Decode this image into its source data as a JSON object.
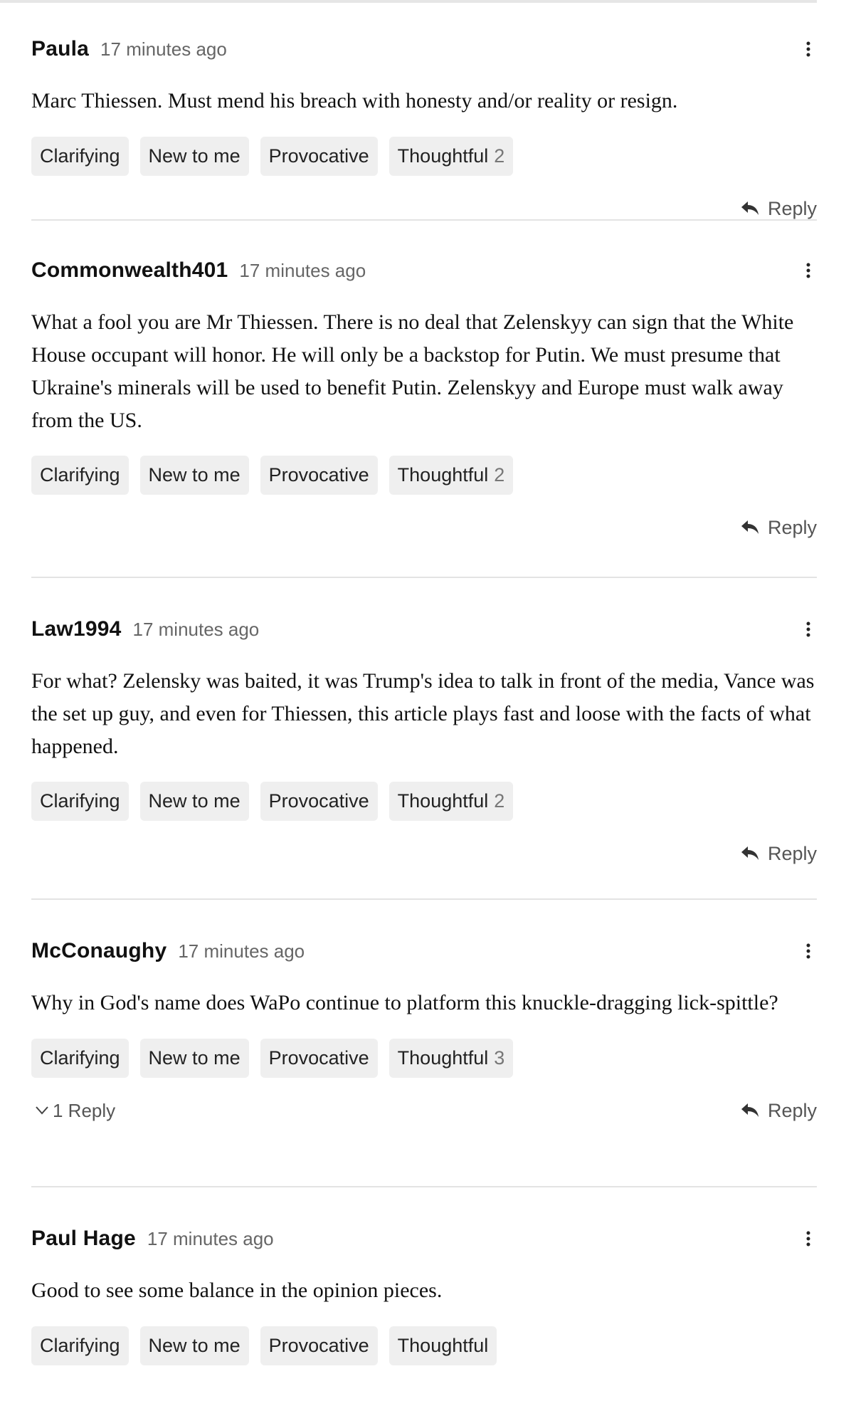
{
  "comments": [
    {
      "author": "Paula",
      "time": "17 minutes ago",
      "body": "Marc Thiessen. Must mend his breach with honesty and/or reality or resign.",
      "reactions": [
        {
          "label": "Clarifying",
          "count": ""
        },
        {
          "label": "New to me",
          "count": ""
        },
        {
          "label": "Provocative",
          "count": ""
        },
        {
          "label": "Thoughtful",
          "count": "2"
        }
      ],
      "replies_label": "",
      "reply_label": "Reply"
    },
    {
      "author": "Commonwealth401",
      "time": "17 minutes ago",
      "body": "What a fool you are Mr Thiessen. There is no deal that Zelenskyy can sign that the White House occupant will honor. He will only be a backstop for Putin. We must presume that Ukraine's minerals will be used to benefit Putin. Zelenskyy and Europe must walk away from the US.",
      "reactions": [
        {
          "label": "Clarifying",
          "count": ""
        },
        {
          "label": "New to me",
          "count": ""
        },
        {
          "label": "Provocative",
          "count": ""
        },
        {
          "label": "Thoughtful",
          "count": "2"
        }
      ],
      "replies_label": "",
      "reply_label": "Reply"
    },
    {
      "author": "Law1994",
      "time": "17 minutes ago",
      "body": "For what? Zelensky was baited, it was Trump's idea to talk in front of the media, Vance was the set up guy, and even for Thiessen, this article plays fast and loose with the facts of what happened.",
      "reactions": [
        {
          "label": "Clarifying",
          "count": ""
        },
        {
          "label": "New to me",
          "count": ""
        },
        {
          "label": "Provocative",
          "count": ""
        },
        {
          "label": "Thoughtful",
          "count": "2"
        }
      ],
      "replies_label": "",
      "reply_label": "Reply"
    },
    {
      "author": "McConaughy",
      "time": "17 minutes ago",
      "body": "Why in God's name does WaPo continue to platform this knuckle-dragging lick-spittle?",
      "reactions": [
        {
          "label": "Clarifying",
          "count": ""
        },
        {
          "label": "New to me",
          "count": ""
        },
        {
          "label": "Provocative",
          "count": ""
        },
        {
          "label": "Thoughtful",
          "count": "3"
        }
      ],
      "replies_label": "1 Reply",
      "reply_label": "Reply"
    },
    {
      "author": "Paul Hage",
      "time": "17 minutes ago",
      "body": "Good to see some balance in the opinion pieces.",
      "reactions": [
        {
          "label": "Clarifying",
          "count": ""
        },
        {
          "label": "New to me",
          "count": ""
        },
        {
          "label": "Provocative",
          "count": ""
        },
        {
          "label": "Thoughtful",
          "count": ""
        }
      ],
      "replies_label": "",
      "reply_label": ""
    }
  ]
}
